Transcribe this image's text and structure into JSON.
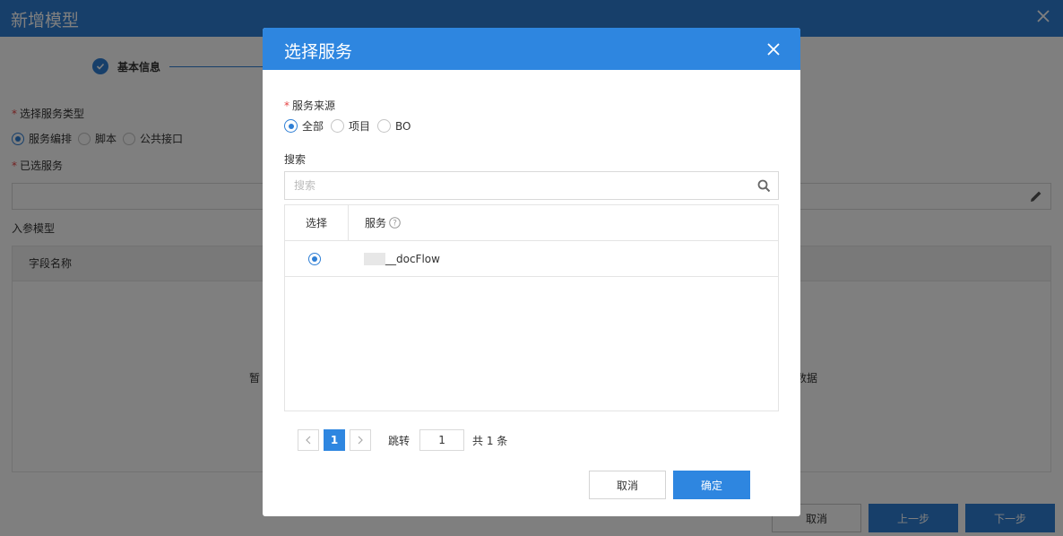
{
  "background": {
    "window_title": "新增模型",
    "step": {
      "label": "基本信息"
    },
    "service_type": {
      "label": "选择服务类型",
      "options": [
        "服务编排",
        "脚本",
        "公共接口"
      ],
      "selected": "服务编排"
    },
    "selected_service_label": "已选服务",
    "input_model_label": "入参模型",
    "table": {
      "header_field": "字段名称",
      "empty_left": "暂",
      "empty_right": "数据"
    },
    "buttons": {
      "cancel": "取消",
      "prev": "上一步",
      "next": "下一步"
    }
  },
  "modal": {
    "title": "选择服务",
    "source": {
      "label": "服务来源",
      "options": [
        "全部",
        "项目",
        "BO"
      ],
      "selected": "全部"
    },
    "search": {
      "label": "搜索",
      "placeholder": "搜索"
    },
    "table": {
      "headers": {
        "select": "选择",
        "service": "服务"
      },
      "rows": [
        {
          "selected": true,
          "service": "__docFlow"
        }
      ]
    },
    "pagination": {
      "current_page": "1",
      "jump_label": "跳转",
      "jump_value": "1",
      "total_text": "共 1 条"
    },
    "buttons": {
      "cancel": "取消",
      "ok": "确定"
    }
  },
  "colors": {
    "primary": "#2e86e0",
    "required": "#e64545"
  }
}
